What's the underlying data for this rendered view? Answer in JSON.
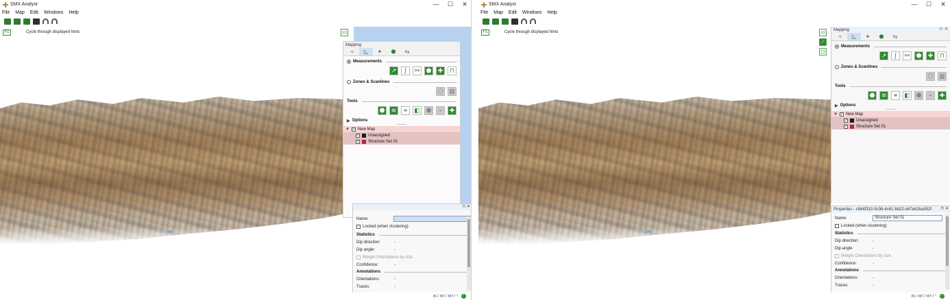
{
  "app": {
    "title": "SMX Analyst"
  },
  "window_controls": {
    "minimize": "—",
    "maximize": "☐",
    "close": "✕"
  },
  "menu": [
    "File",
    "Map",
    "Edit",
    "Windows",
    "Help"
  ],
  "viewport": {
    "hint_key": "F1",
    "hint_text": "Cycle through displayed hints"
  },
  "mapping_panel": {
    "title": "Mapping",
    "measurements_label": "Measurements",
    "zones_label": "Zones & Scanlines",
    "tools_label": "Tools",
    "options_label": "Options",
    "measurement_icons": [
      "↗",
      "∫",
      "⚯",
      "⬟",
      "✚",
      "⊓"
    ],
    "zone_icons": [
      "⬡",
      "▦"
    ],
    "tool_icons": [
      "⬣",
      "≋",
      "⚭",
      "◧",
      "⬢",
      "⌁",
      "✚"
    ]
  },
  "tree": {
    "map_label": "New Map",
    "items": [
      {
        "label": "Unassigned",
        "color": "#1a1a1a"
      },
      {
        "label": "Structure Set 01",
        "color": "#b3253f"
      }
    ]
  },
  "properties": {
    "title": "Properties - c8d4f310-9c36-4c61-bb22-d47eb2ba952f",
    "name_label": "Name:",
    "name_value": "Structure Set 01",
    "locked_label": "Locked (when clustering)",
    "statistics_label": "Statistics",
    "dip_direction_label": "Dip direction:",
    "dip_direction_value": "-",
    "dip_angle_label": "Dip angle:",
    "dip_angle_value": "-",
    "weight_label": "Weight Orientations by size",
    "confidence_label": "Confidence:",
    "confidence_value": "-",
    "annotations_label": "Annotations",
    "orientations_label": "Orientations:",
    "orientations_value": "-",
    "traces_label": "Traces:",
    "traces_value": "-"
  },
  "status": {
    "units": "m / m² / m³ / °",
    "info_icon": "i"
  }
}
